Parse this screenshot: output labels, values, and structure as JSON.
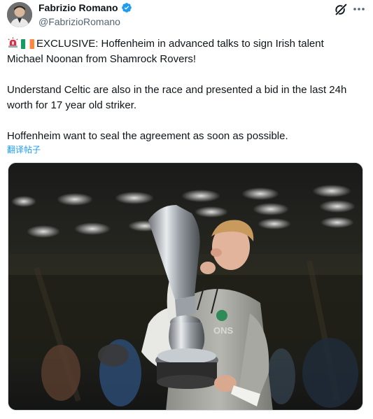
{
  "author": {
    "display_name": "Fabrizio Romano",
    "handle": "@FabrizioRomano",
    "verified": true,
    "avatar_icon": "avatar-portrait"
  },
  "header_actions": {
    "grok_icon": "grok-icon",
    "more_icon": "more-horizontal-icon"
  },
  "tweet": {
    "line1": "EXCLUSIVE: Hoffenheim in advanced talks to sign Irish talent",
    "line2": "Michael Noonan from Shamrock Rovers!",
    "line3": "Understand Celtic are also in the race and presented a bid in the last 24h",
    "line4": "worth for 17 year old striker.",
    "line5": "Hoffenheim want to seal the agreement as soon as possible.",
    "translate_label": "翻译帖子",
    "emojis": [
      "rotating-light",
      "flag-ireland"
    ]
  },
  "media": {
    "kind": "photo",
    "jersey_text": "ONS"
  },
  "colors": {
    "text": "#0f1419",
    "secondary": "#536471",
    "link": "#1d9bf0",
    "verified": "#1d9bf0"
  }
}
